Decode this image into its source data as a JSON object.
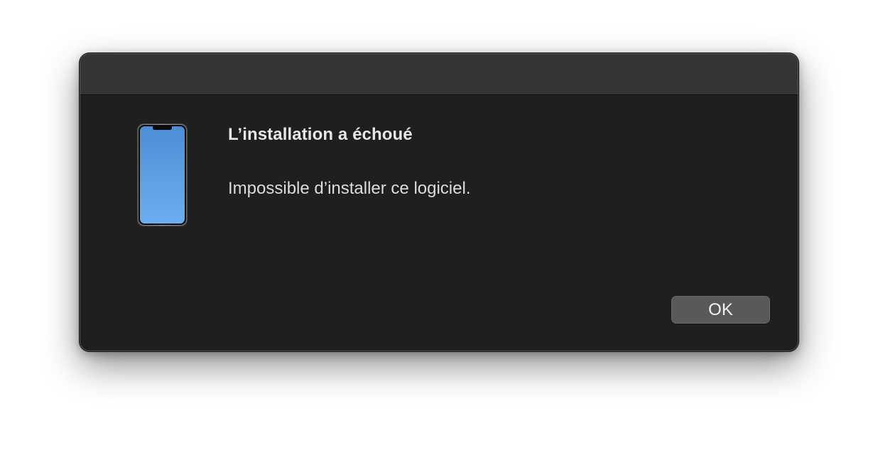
{
  "dialog": {
    "icon": "iphone-icon",
    "title": "L’installation a échoué",
    "message": "Impossible d’installer ce logiciel.",
    "ok_label": "OK"
  },
  "colors": {
    "window_bg": "#1f1f1f",
    "titlebar_bg": "#353535",
    "button_bg": "#595959",
    "screen_top": "#4d8ed4",
    "screen_bottom": "#6aaef0"
  }
}
